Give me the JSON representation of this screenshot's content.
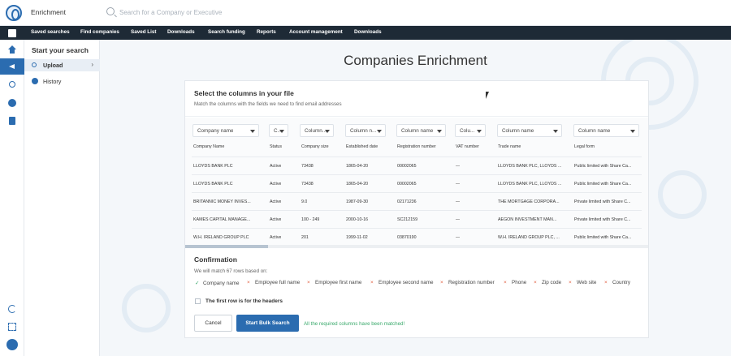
{
  "header": {
    "app_title": "Enrichment",
    "search_placeholder": "Search for a Company or Executive"
  },
  "nav": [
    {
      "label": "Saved searches"
    },
    {
      "label": "Find companies"
    },
    {
      "label": "Saved List"
    },
    {
      "label": "Downloads"
    },
    {
      "label": "Search funding"
    },
    {
      "label": "Reports"
    },
    {
      "label": "Account management"
    },
    {
      "label": "Downloads"
    }
  ],
  "sidebar": {
    "title": "Start your search",
    "items": [
      {
        "label": "Upload",
        "icon": "search-icon",
        "active": true
      },
      {
        "label": "History",
        "icon": "check-circle-icon",
        "active": false
      }
    ]
  },
  "page": {
    "title": "Companies Enrichment"
  },
  "columns_section": {
    "title": "Select the columns in your file",
    "subtitle": "Match the columns with the fields we need to find email addresses"
  },
  "table": {
    "selects": [
      "Company name",
      "C...",
      "Column...",
      "Column n...",
      "Column name",
      "Colu...",
      "Column name",
      "Column name"
    ],
    "headers": [
      "Company Name",
      "Status",
      "Company size",
      "Established date",
      "Registration number",
      "VAT number",
      "Trade name",
      "Legal form"
    ],
    "rows": [
      [
        "LLOYDS BANK PLC",
        "Active",
        "73438",
        "1865-04-20",
        "00002065",
        "—",
        "LLOYDS BANK PLC, LLOYDS ...",
        "Public limited with Share Ca..."
      ],
      [
        "LLOYDS BANK PLC",
        "Active",
        "73438",
        "1865-04-20",
        "00002065",
        "—",
        "LLOYDS BANK PLC, LLOYDS ...",
        "Public limited with Share Ca..."
      ],
      [
        "BRITANNIC MONEY INVES...",
        "Active",
        "9.0",
        "1987-09-30",
        "02171236",
        "—",
        "THE MORTGAGE CORPORA...",
        "Private limited with Share C..."
      ],
      [
        "KAMES CAPITAL MANAGE...",
        "Active",
        "100 - 249",
        "2000-10-16",
        "SC212159",
        "—",
        "AEGON INVESTMENT MAN...",
        "Private limited with Share C..."
      ],
      [
        "W.H. IRELAND GROUP PLC",
        "Active",
        "201",
        "1999-11-02",
        "03870190",
        "—",
        "W.H. IRELAND GROUP PLC, ...",
        "Public limited with Share Ca..."
      ]
    ]
  },
  "confirmation": {
    "title": "Confirmation",
    "subtitle": "We will match 67 rows based on:",
    "items": [
      {
        "label": "Company name",
        "matched": true
      },
      {
        "label": "Employee full name",
        "matched": false
      },
      {
        "label": "Employee first name",
        "matched": false
      },
      {
        "label": "Employee second name",
        "matched": false
      },
      {
        "label": "Registration number",
        "matched": false
      },
      {
        "label": "Phone",
        "matched": false
      },
      {
        "label": "Zip code",
        "matched": false
      },
      {
        "label": "Web site",
        "matched": false
      },
      {
        "label": "Country",
        "matched": false
      }
    ],
    "first_row_label": "The first row is for the headers",
    "cancel_label": "Cancel",
    "start_label": "Start Bulk Search",
    "matched_note": "All the required columns have been matched!"
  },
  "colors": {
    "accent": "#2b6cb0",
    "nav_bg": "#1e2a36",
    "success": "#39a96b",
    "error": "#e05a3a"
  }
}
